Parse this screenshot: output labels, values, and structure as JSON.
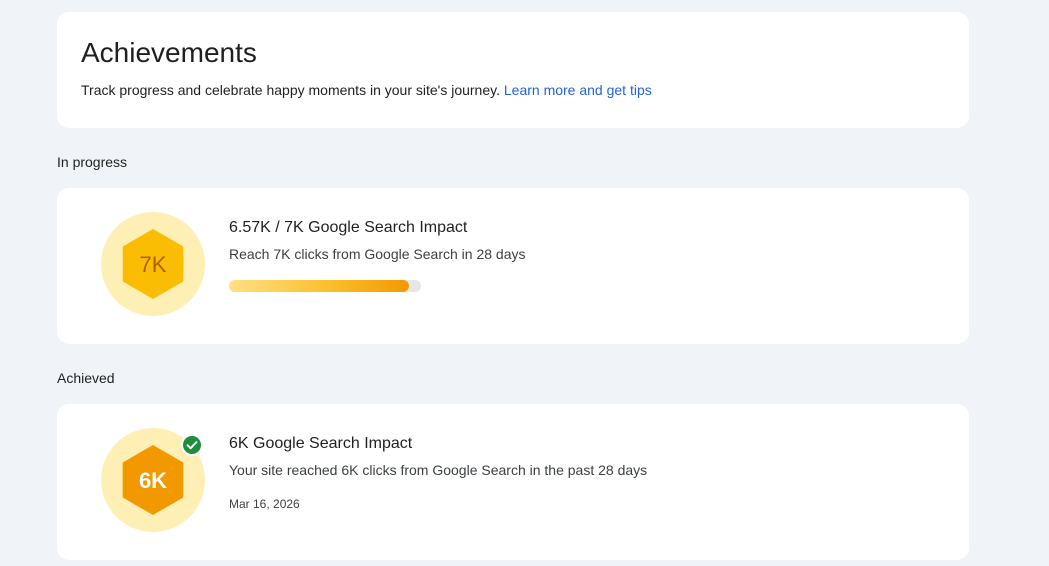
{
  "header": {
    "title": "Achievements",
    "description": "Track progress and celebrate happy moments in your site's journey.",
    "learn_more_link": "Learn more and get tips"
  },
  "in_progress": {
    "section_label": "In progress",
    "item": {
      "badge_label": "7K",
      "title": "6.57K / 7K Google Search Impact",
      "description": "Reach 7K clicks from Google Search in 28 days",
      "progress_fraction": 0.9386,
      "badge_colors": {
        "circle": "#fef0b4",
        "hexagon": "#fbbc04",
        "text": "#b06000"
      }
    }
  },
  "achieved": {
    "section_label": "Achieved",
    "item": {
      "badge_label": "6K",
      "title": "6K Google Search Impact",
      "description": "Your site reached 6K clicks from Google Search in the past 28 days",
      "date": "Mar 16, 2026",
      "status_icon": "check-circle-icon",
      "badge_colors": {
        "circle": "#fef0b4",
        "hexagon": "#f29900",
        "text": "#ffffff",
        "check": "#1e8e3e"
      }
    }
  }
}
